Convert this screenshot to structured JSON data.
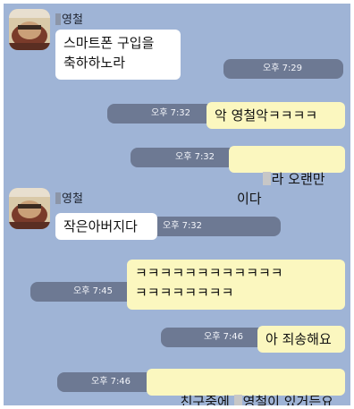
{
  "chat": {
    "blocks": [
      {
        "sender": "영철",
        "messages": [
          {
            "direction": "in",
            "text": "스마트폰 구입을\n축하하노라",
            "time": "오후 7:29"
          }
        ]
      },
      {
        "messages": [
          {
            "direction": "out",
            "text": "악 영철악ㅋㅋㅋㅋ",
            "time": "오후 7:32"
          },
          {
            "direction": "out",
            "text_after_censor": "라 오랜만이다",
            "time": "오후 7:32"
          }
        ]
      },
      {
        "sender": "영철",
        "messages": [
          {
            "direction": "in",
            "text": "작은아버지다",
            "time": "오후 7:32"
          }
        ]
      },
      {
        "messages": [
          {
            "direction": "out",
            "text": "ㅋㅋㅋㅋㅋㅋㅋㅋㅋㅋㅋㅋ\nㅋㅋㅋㅋㅋㅋㅋㅋ",
            "time": "오후 7:45"
          },
          {
            "direction": "out",
            "text": "아 죄송해요",
            "time": "오후 7:46"
          },
          {
            "direction": "out",
            "text_before_censor": "친구중에 ",
            "text_after_censor": "영철이 있거든요",
            "time": "오후 7:46"
          }
        ]
      }
    ]
  }
}
